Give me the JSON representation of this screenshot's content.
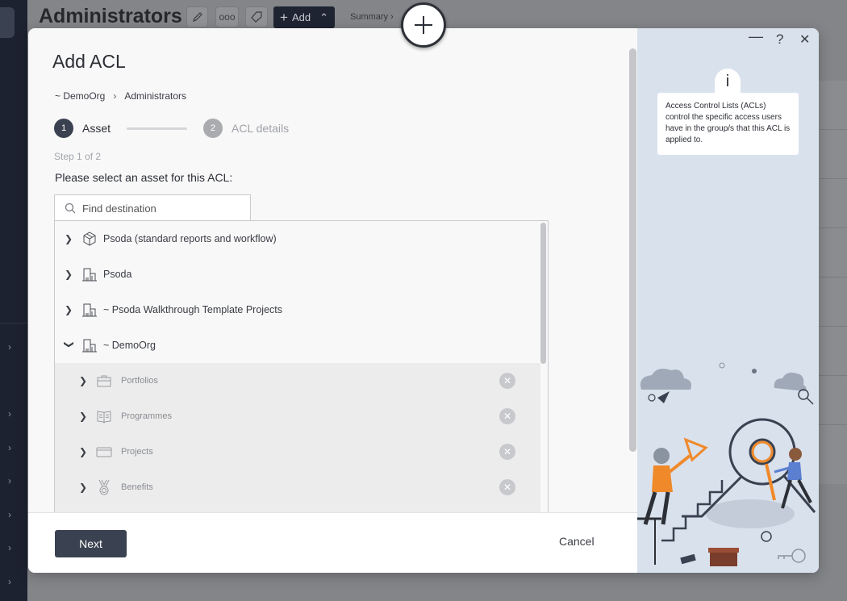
{
  "background": {
    "page_title": "Administrators",
    "add_label": "Add",
    "summary_label": "Summary ›"
  },
  "modal": {
    "title": "Add ACL",
    "breadcrumb": [
      "~ DemoOrg",
      "Administrators"
    ],
    "steps": [
      {
        "number": "1",
        "label": "Asset",
        "active": true
      },
      {
        "number": "2",
        "label": "ACL details",
        "active": false
      }
    ],
    "step_count": "Step 1 of 2",
    "prompt": "Please select an asset for this ACL:",
    "search_placeholder": "Find destination",
    "tree": [
      {
        "label": "Psoda (standard reports and workflow)",
        "icon": "box-icon",
        "expanded": false,
        "level": 0
      },
      {
        "label": "Psoda",
        "icon": "building-icon",
        "expanded": false,
        "level": 0
      },
      {
        "label": "~ Psoda Walkthrough Template Projects",
        "icon": "building-icon",
        "expanded": false,
        "level": 0
      },
      {
        "label": "~ DemoOrg",
        "icon": "building-icon",
        "expanded": true,
        "level": 0
      },
      {
        "label": "Portfolios",
        "icon": "briefcase-icon",
        "expanded": false,
        "level": 1
      },
      {
        "label": "Programmes",
        "icon": "book-icon",
        "expanded": false,
        "level": 1
      },
      {
        "label": "Projects",
        "icon": "folder-icon",
        "expanded": false,
        "level": 1
      },
      {
        "label": "Benefits",
        "icon": "medal-icon",
        "expanded": false,
        "level": 1
      }
    ],
    "next_label": "Next",
    "cancel_label": "Cancel",
    "info_text": "Access Control Lists (ACLs) control the specific access users have in the group/s that this ACL is applied to.",
    "info_tab_glyph": "i",
    "controls": {
      "minimize": "—",
      "help": "?",
      "close": "✕"
    }
  },
  "colors": {
    "primary": "#3a4150",
    "panel": "#d9e1ec",
    "accent": "#f0892a"
  }
}
